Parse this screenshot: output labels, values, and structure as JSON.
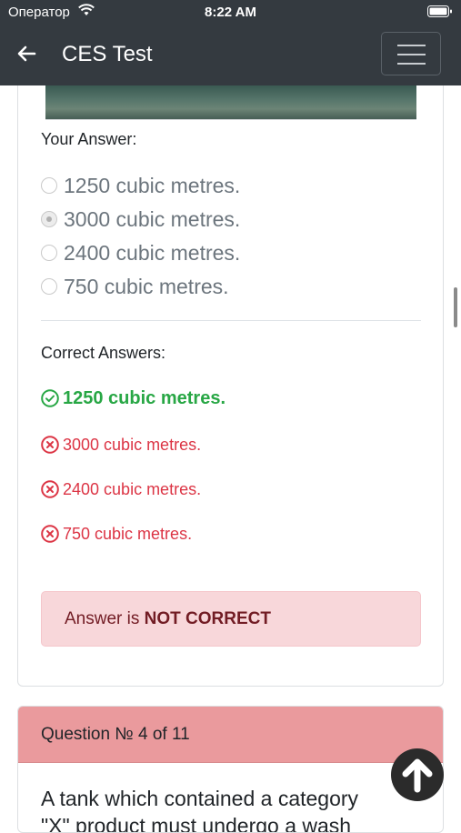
{
  "status_bar": {
    "carrier": "Оператор",
    "time": "8:22 AM"
  },
  "navbar": {
    "title": "CES Test"
  },
  "question": {
    "your_answer_label": "Your Answer:",
    "options": [
      {
        "text": "1250 cubic metres.",
        "selected": false
      },
      {
        "text": "3000 cubic metres.",
        "selected": true
      },
      {
        "text": "2400 cubic metres.",
        "selected": false
      },
      {
        "text": "750 cubic metres.",
        "selected": false
      }
    ],
    "correct_answers_label": "Correct Answers:",
    "answers": [
      {
        "text": "1250 cubic metres.",
        "correct": true
      },
      {
        "text": "3000 cubic metres.",
        "correct": false
      },
      {
        "text": "2400 cubic metres.",
        "correct": false
      },
      {
        "text": "750 cubic metres.",
        "correct": false
      }
    ],
    "result": {
      "prefix": "Answer is ",
      "verdict": "NOT CORRECT"
    }
  },
  "next_question": {
    "number_label": "Question № 4 of 11",
    "text_line1": "A tank which contained a category",
    "text_line2": "\"X\" product must undergo a wash"
  },
  "colors": {
    "correct": "#28a745",
    "wrong": "#dc3545",
    "navbar": "#343a40",
    "alert_bg": "#f8d7da"
  }
}
